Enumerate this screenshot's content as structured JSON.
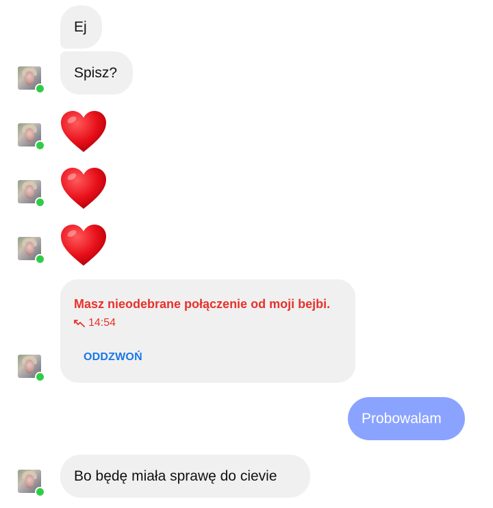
{
  "messages": {
    "m1": {
      "text": "Ej"
    },
    "m2": {
      "text": "Spisz?"
    },
    "m3": {
      "emoji": "heart"
    },
    "m4": {
      "emoji": "heart"
    },
    "m5": {
      "emoji": "heart"
    },
    "missed_call": {
      "title": "Masz nieodebrane połączenie od moji bejbi.",
      "time": "14:54",
      "action_label": "ODDZWOŃ"
    },
    "m6": {
      "text": "Probowalam"
    },
    "m7": {
      "text": "Bo będę miała sprawę do cievie"
    }
  },
  "colors": {
    "incoming_bubble": "#f0f0f0",
    "outgoing_bubble": "#8aa3ff",
    "missed_call_text": "#e8312a",
    "call_back_link": "#1877e8",
    "online_dot": "#31cc46"
  }
}
